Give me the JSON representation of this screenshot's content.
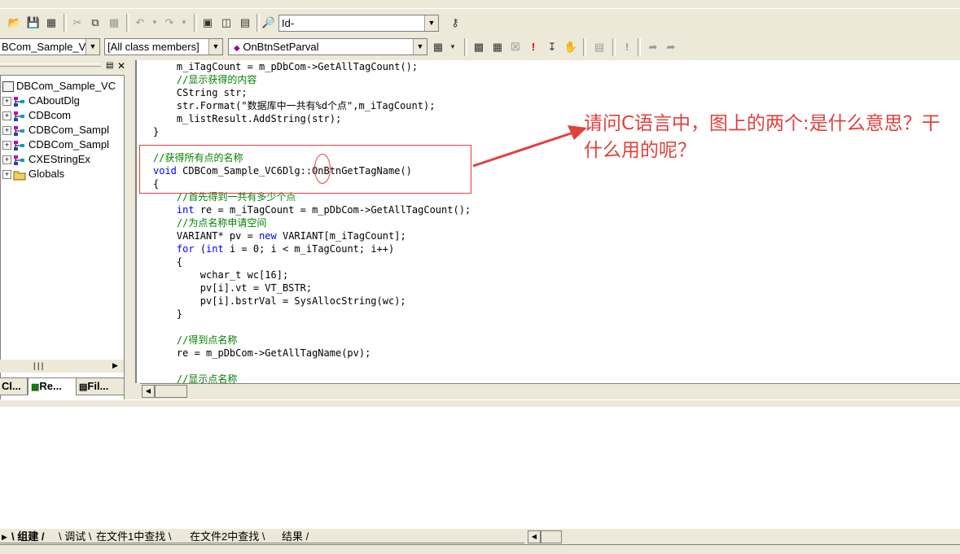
{
  "toolbar1": {
    "search_combo_value": "Id-"
  },
  "toolbar2": {
    "class_combo_value": "BCom_Sample_V",
    "filter_combo_value": "[All class members]",
    "member_combo_value": "OnBtnSetParval"
  },
  "workspace": {
    "tree": [
      {
        "label": "DBCom_Sample_VC",
        "icon": "project-icon",
        "expander": ""
      },
      {
        "label": "CAboutDlg",
        "icon": "class-icon",
        "expander": "+"
      },
      {
        "label": "CDBcom",
        "icon": "class-icon",
        "expander": "+"
      },
      {
        "label": "CDBCom_Sampl",
        "icon": "class-icon",
        "expander": "+"
      },
      {
        "label": "CDBCom_Sampl",
        "icon": "class-icon",
        "expander": "+"
      },
      {
        "label": "CXEStringEx",
        "icon": "class-icon",
        "expander": "+"
      },
      {
        "label": "Globals",
        "icon": "folder-icon",
        "expander": "+"
      }
    ],
    "tabs": [
      "Cl...",
      "Re...",
      "Fil..."
    ]
  },
  "editor": {
    "lines": [
      {
        "indent": "    ",
        "parts": [
          {
            "t": "m_iTagCount = m_pDbCom->GetAllTagCount();",
            "c": ""
          }
        ]
      },
      {
        "indent": "    ",
        "parts": [
          {
            "t": "//显示获得的内容",
            "c": "cm"
          }
        ]
      },
      {
        "indent": "    ",
        "parts": [
          {
            "t": "CString str;",
            "c": ""
          }
        ]
      },
      {
        "indent": "    ",
        "parts": [
          {
            "t": "str.Format(\"数据库中一共有%d个点\",m_iTagCount);",
            "c": ""
          }
        ]
      },
      {
        "indent": "    ",
        "parts": [
          {
            "t": "m_listResult.AddString(str);",
            "c": ""
          }
        ]
      },
      {
        "indent": "",
        "parts": [
          {
            "t": "}",
            "c": ""
          }
        ]
      },
      {
        "indent": "",
        "parts": [
          {
            "t": "",
            "c": ""
          }
        ]
      },
      {
        "indent": "",
        "parts": [
          {
            "t": "//获得所有点的名称",
            "c": "cm"
          }
        ]
      },
      {
        "indent": "",
        "parts": [
          {
            "t": "void",
            "c": "kw"
          },
          {
            "t": " CDBCom_Sample_VC6Dlg::OnBtnGetTagName()",
            "c": ""
          }
        ]
      },
      {
        "indent": "",
        "parts": [
          {
            "t": "{",
            "c": ""
          }
        ]
      },
      {
        "indent": "    ",
        "parts": [
          {
            "t": "//首先得到一共有多少个点",
            "c": "cm"
          }
        ]
      },
      {
        "indent": "    ",
        "parts": [
          {
            "t": "int",
            "c": "kw"
          },
          {
            "t": " re = m_iTagCount = m_pDbCom->GetAllTagCount();",
            "c": ""
          }
        ]
      },
      {
        "indent": "    ",
        "parts": [
          {
            "t": "//为点名称申请空间",
            "c": "cm"
          }
        ]
      },
      {
        "indent": "    ",
        "parts": [
          {
            "t": "VARIANT* pv = ",
            "c": ""
          },
          {
            "t": "new",
            "c": "kw"
          },
          {
            "t": " VARIANT[m_iTagCount];",
            "c": ""
          }
        ]
      },
      {
        "indent": "    ",
        "parts": [
          {
            "t": "for",
            "c": "kw"
          },
          {
            "t": " (",
            "c": ""
          },
          {
            "t": "int",
            "c": "kw"
          },
          {
            "t": " i = 0; i < m_iTagCount; i++)",
            "c": ""
          }
        ]
      },
      {
        "indent": "    ",
        "parts": [
          {
            "t": "{",
            "c": ""
          }
        ]
      },
      {
        "indent": "        ",
        "parts": [
          {
            "t": "wchar_t wc[16];",
            "c": ""
          }
        ]
      },
      {
        "indent": "        ",
        "parts": [
          {
            "t": "pv[i].vt = VT_BSTR;",
            "c": ""
          }
        ]
      },
      {
        "indent": "        ",
        "parts": [
          {
            "t": "pv[i].bstrVal = SysAllocString(wc);",
            "c": ""
          }
        ]
      },
      {
        "indent": "    ",
        "parts": [
          {
            "t": "}",
            "c": ""
          }
        ]
      },
      {
        "indent": "",
        "parts": [
          {
            "t": "",
            "c": ""
          }
        ]
      },
      {
        "indent": "    ",
        "parts": [
          {
            "t": "//得到点名称",
            "c": "cm"
          }
        ]
      },
      {
        "indent": "    ",
        "parts": [
          {
            "t": "re = m_pDbCom->GetAllTagName(pv);",
            "c": ""
          }
        ]
      },
      {
        "indent": "",
        "parts": [
          {
            "t": "",
            "c": ""
          }
        ]
      },
      {
        "indent": "    ",
        "parts": [
          {
            "t": "//显示点名称",
            "c": "cm"
          }
        ]
      }
    ]
  },
  "output_tabs": [
    "组建",
    "调试",
    "在文件1中查找",
    "在文件2中查找",
    "结果"
  ],
  "annotation": {
    "text": "请问C语言中，图上的两个:是什么意思？干什么用的呢？",
    "color": "#e2403a"
  },
  "colors": {
    "keyword": "#0000ff",
    "comment": "#008000",
    "annotation": "#e2403a"
  }
}
